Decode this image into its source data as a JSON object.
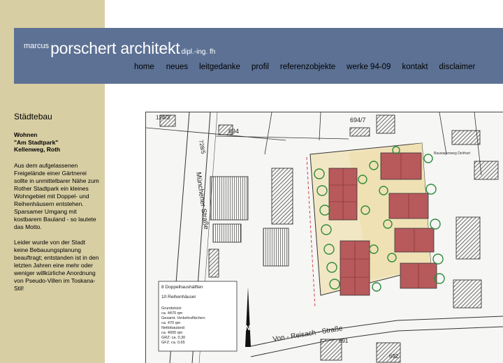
{
  "brand": {
    "first_name": "marcus",
    "last_name": "porschert architekt",
    "title": "dipl.-ing. fh"
  },
  "nav": {
    "items": [
      "home",
      "neues",
      "leitgedanke",
      "profil",
      "referenzobjekte",
      "werke 94-09",
      "kontakt",
      "disclaimer"
    ]
  },
  "section": {
    "title": "Städtebau"
  },
  "project": {
    "line1": "Wohnen",
    "line2": "\"Am Stadtpark\"",
    "line3": "Kellenweg, Roth"
  },
  "description": {
    "p1": "Aus dem aufgelassenen Freigelände einer Gärtnerei sollte in unmittelbarer Nähe zum Rother Stadtpark ein kleines Wohngebiet mit Doppel- und Reihenhäusern entstehen. Sparsamer Umgang mit kostbarem Bauland - so lautete das Motto.",
    "p2": "Leider wurde von der Stadt keine Bebauungsplanung beauftragt; entstanden ist in den letzten Jahren eine mehr oder weniger willkürliche Anordnung von Pseudo-Villen im Toskana-Stil!"
  },
  "plan": {
    "street_1": "Münchener Straße",
    "street_2": "Von - Reisach - Straße",
    "parcel_1": "694",
    "parcel_2": "694/7",
    "parcel_3": "124/3",
    "parcel_4": "728/5",
    "parcel_5": "691",
    "parcel_6": "692",
    "legend_1": "8 Doppelhaushälften",
    "legend_2": "10 Reihenhäuser",
    "stats_1": "Grundstück:",
    "stats_2": "ca. 4470 qm",
    "stats_3": "Gesamt. Verkehrsflächen:",
    "stats_4": "ca. 470 qm",
    "stats_5": "Nettobauland:",
    "stats_6": "ca. 4000 qm",
    "stats_7": "GRZ: ca. 0,30",
    "stats_8": "GFZ: ca. 0,65",
    "label_1": "Kellenweg",
    "label_2": "Bauwagenweg Delrhart",
    "north": "N"
  },
  "colors": {
    "left_strip": "#d8cea3",
    "header_bar": "#5c7194",
    "roof": "#b8595c",
    "tree": "#2e8b3a",
    "site_fill": "#f2e7c4"
  }
}
